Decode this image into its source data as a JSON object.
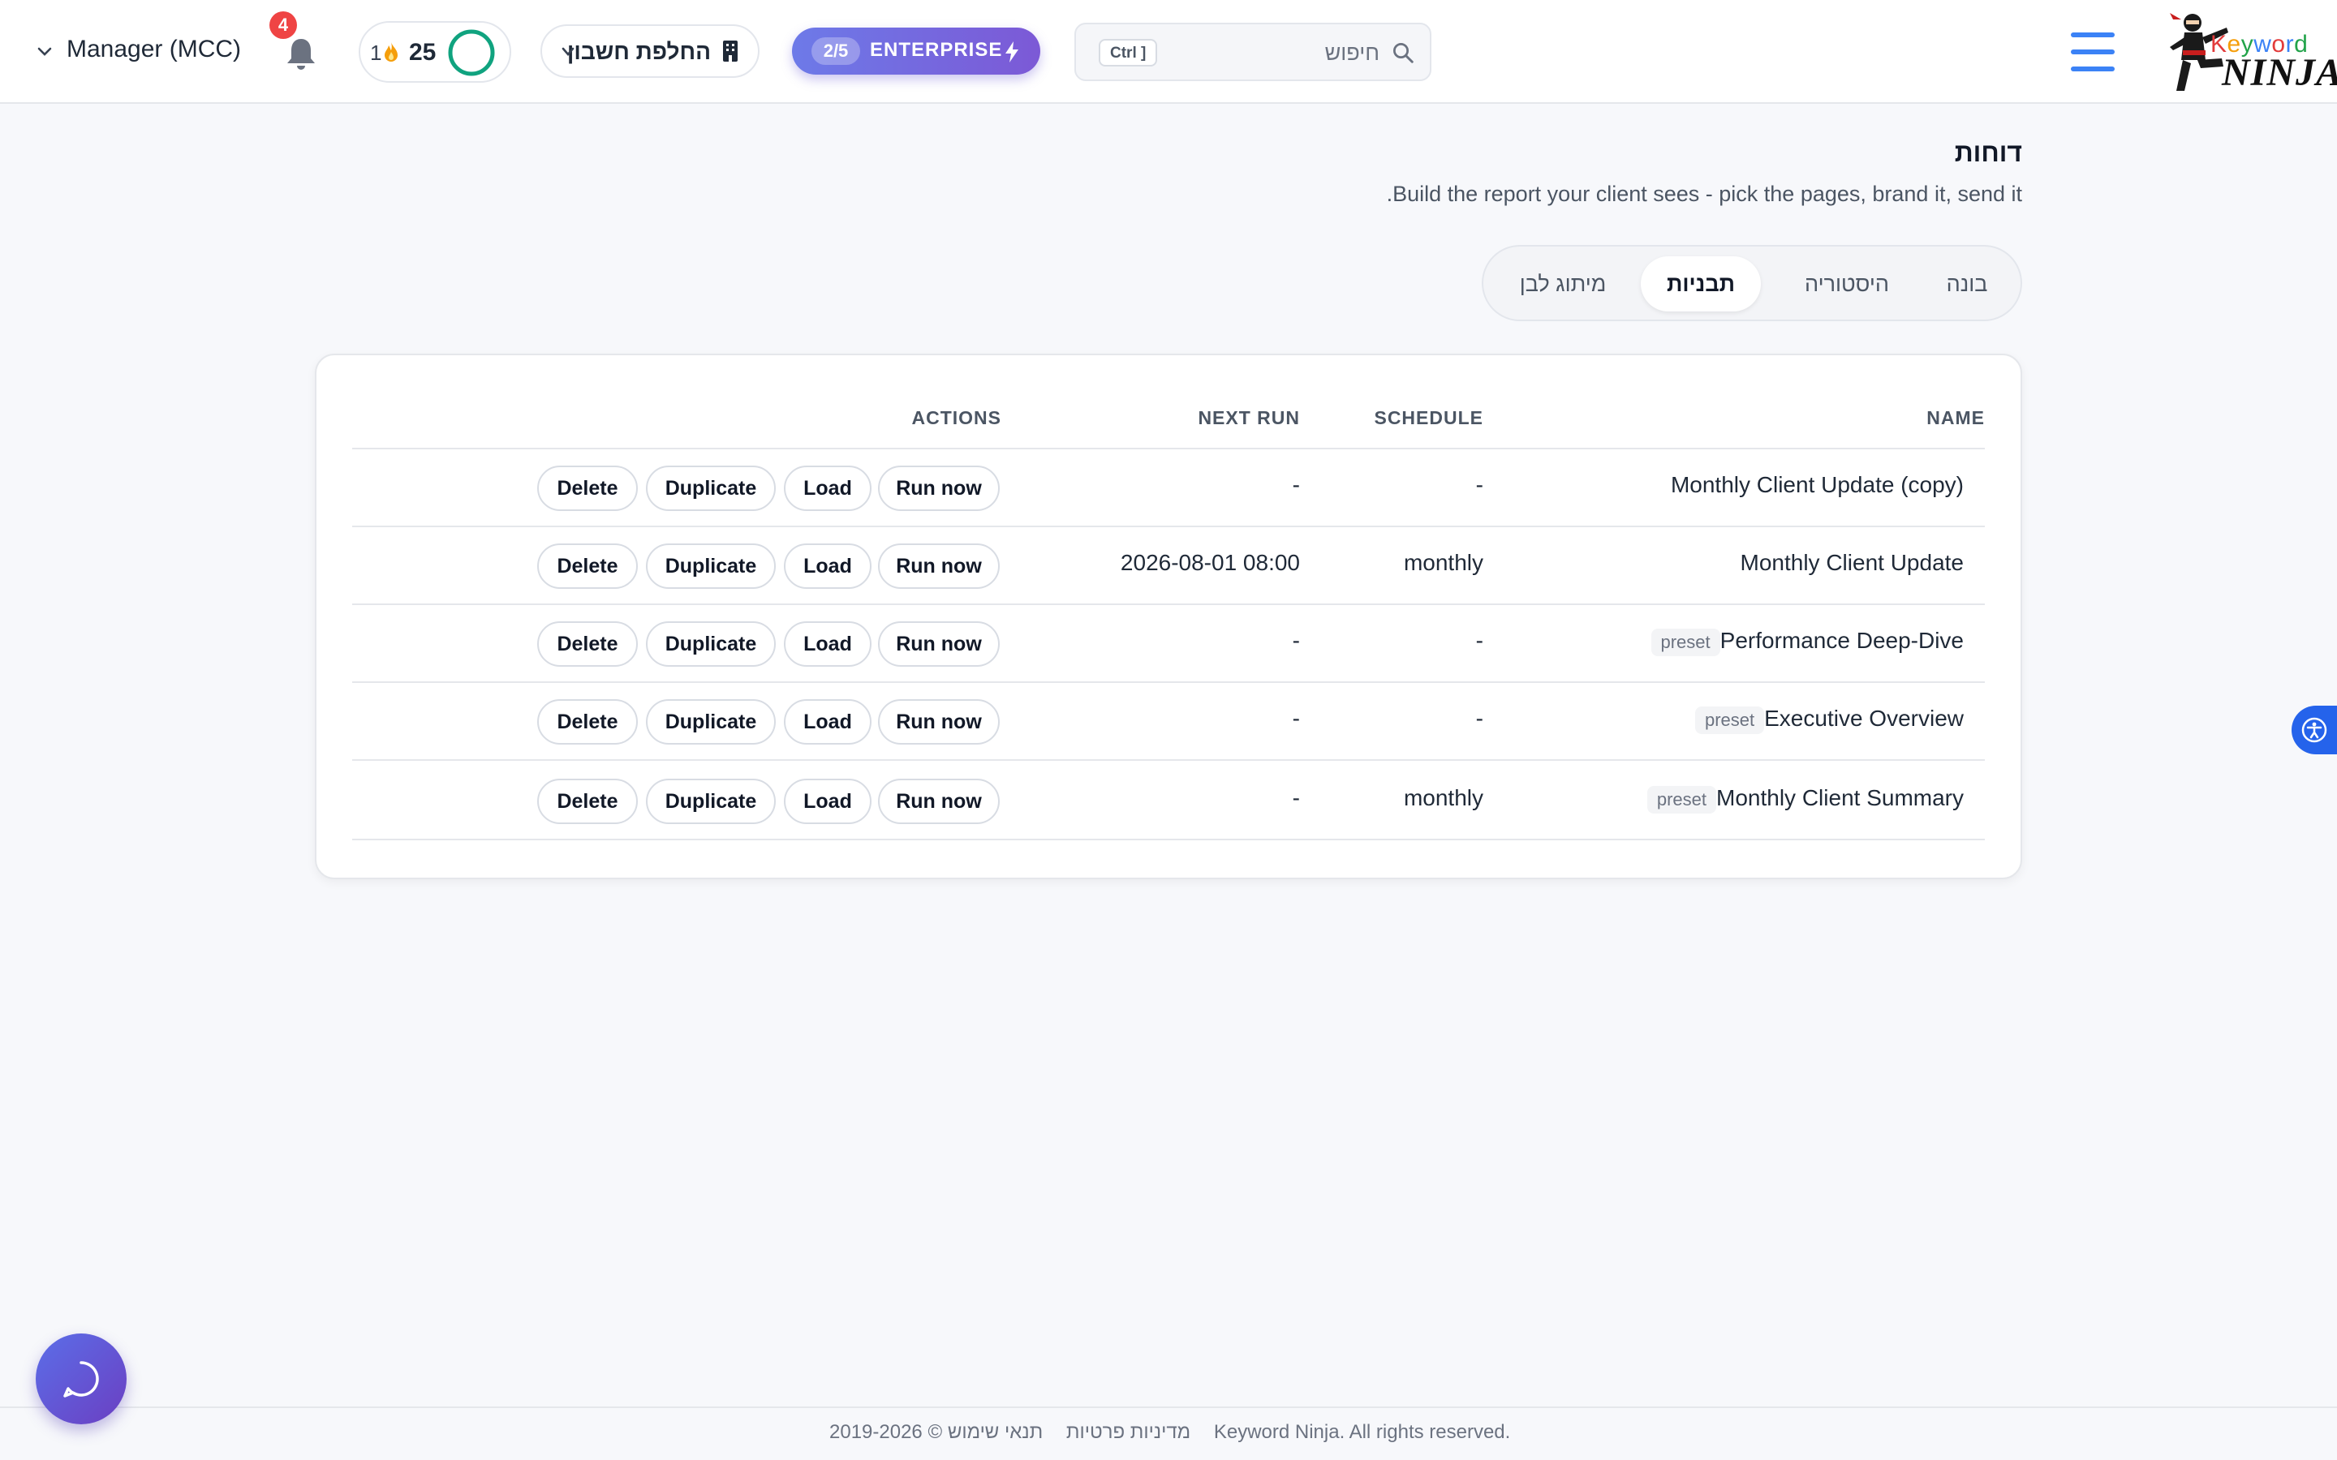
{
  "header": {
    "logo_text_top": "Keyword",
    "logo_text_bottom": "NINJA",
    "search": {
      "placeholder": "חיפוש",
      "kbd": "Ctrl ]"
    },
    "plan": {
      "usage": "2/5",
      "label": "ENTERPRISE"
    },
    "switch_account_label": "החלפת חשבון",
    "credits": {
      "streak": "1",
      "points": "25"
    },
    "notifications_count": "4",
    "account_label": "Manager (MCC)"
  },
  "page": {
    "title": "דוחות",
    "subtitle": "Build the report your client sees - pick the pages, brand it, send it."
  },
  "tabs": [
    {
      "label": "בונה",
      "active": false
    },
    {
      "label": "היסטוריה",
      "active": false
    },
    {
      "label": "תבניות",
      "active": true
    },
    {
      "label": "מיתוג לבן",
      "active": false
    }
  ],
  "table": {
    "headers": {
      "name": "NAME",
      "schedule": "SCHEDULE",
      "next_run": "NEXT RUN",
      "actions": "ACTIONS"
    },
    "actions": {
      "run": "Run now",
      "load": "Load",
      "duplicate": "Duplicate",
      "delete": "Delete"
    },
    "preset_label": "preset",
    "rows": [
      {
        "name": "Monthly Client Update (copy)",
        "preset": false,
        "schedule": "-",
        "next_run": "-"
      },
      {
        "name": "Monthly Client Update",
        "preset": false,
        "schedule": "monthly",
        "next_run": "2026-08-01 08:00"
      },
      {
        "name": "Performance Deep-Dive",
        "preset": true,
        "schedule": "-",
        "next_run": "-"
      },
      {
        "name": "Executive Overview",
        "preset": true,
        "schedule": "-",
        "next_run": "-"
      },
      {
        "name": "Monthly Client Summary",
        "preset": true,
        "schedule": "monthly",
        "next_run": "-"
      }
    ]
  },
  "footer": {
    "copyright": "© 2019-2026 Keyword Ninja. All rights reserved.",
    "terms": "תנאי שימוש",
    "privacy": "מדיניות פרטיות"
  },
  "colors": {
    "accent": "#3b82f6",
    "enterprise_start": "#6d7ae8",
    "enterprise_end": "#7c59d6",
    "badge": "#ef4444",
    "ring": "#10a37f"
  },
  "icons": [
    "hamburger-icon",
    "search-icon",
    "bolt-icon",
    "building-icon",
    "chevron-down-icon",
    "flame-icon",
    "progress-ring-icon",
    "bell-icon",
    "chat-icon",
    "accessibility-icon"
  ]
}
